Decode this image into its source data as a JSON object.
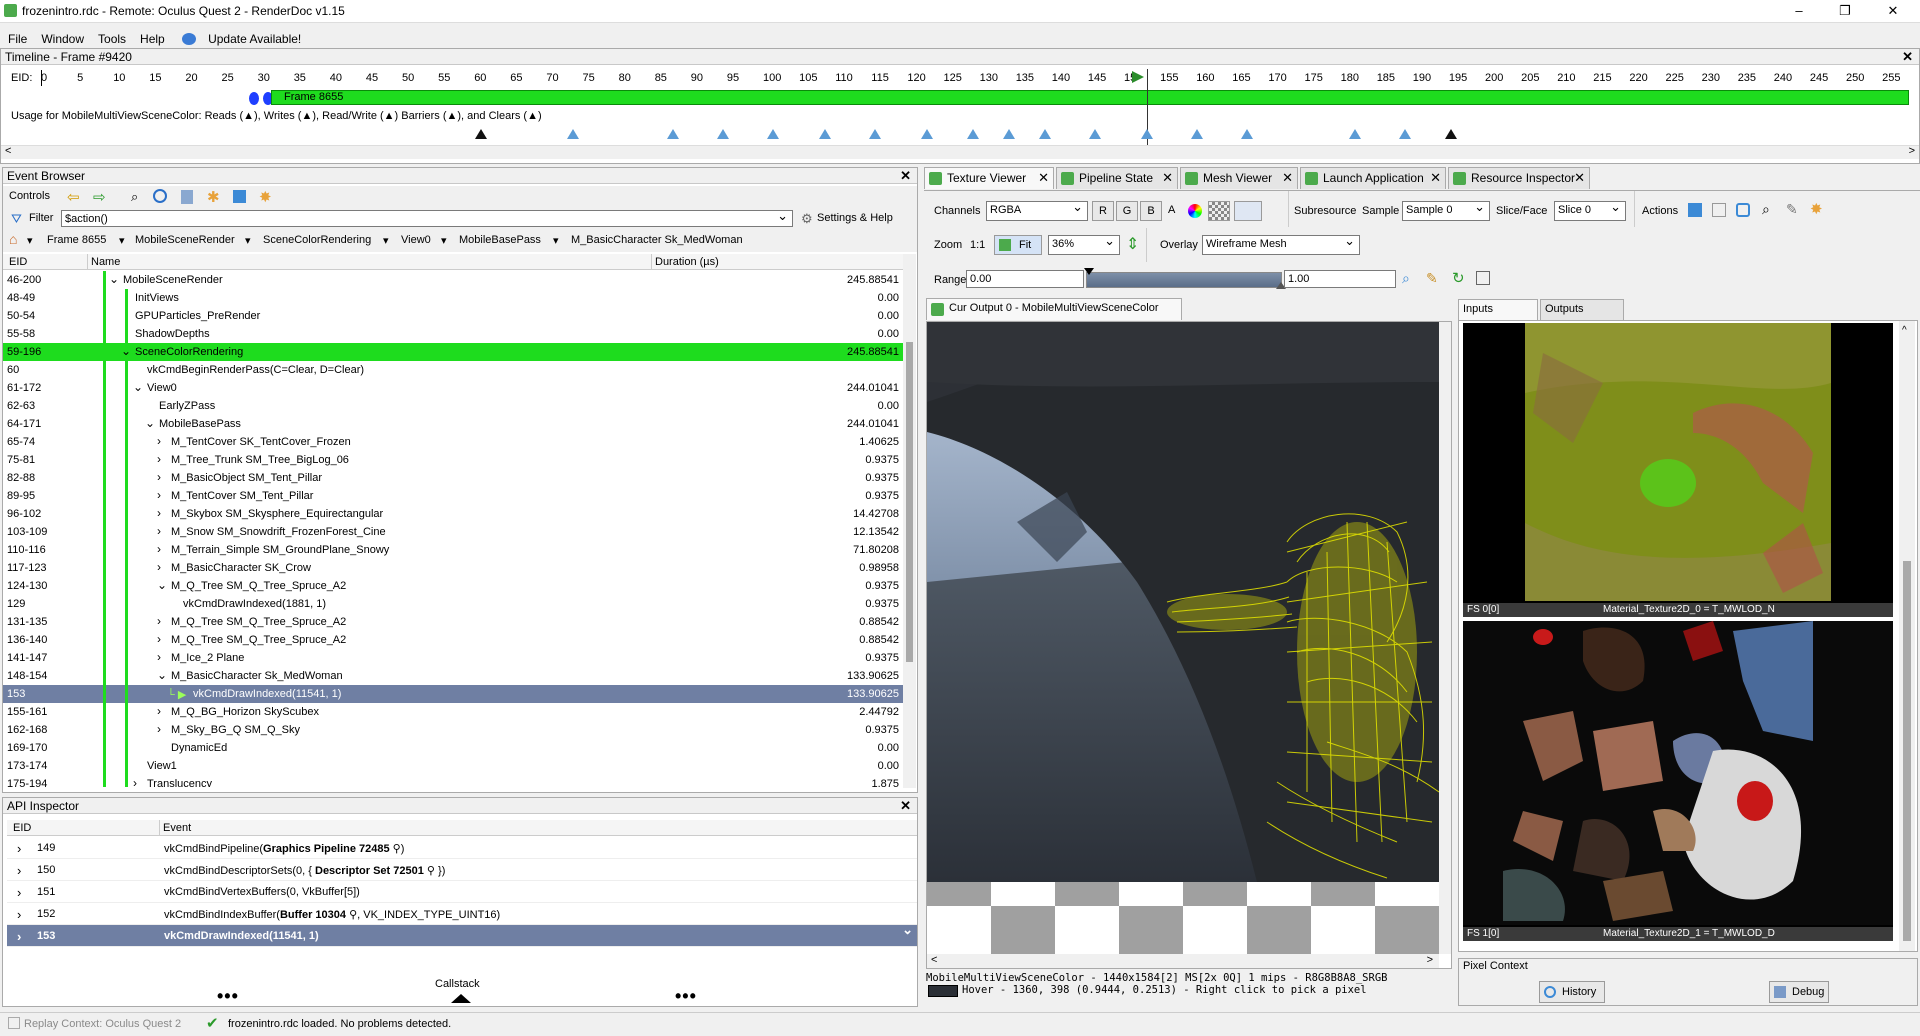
{
  "window": {
    "title": "frozenintro.rdc - Remote: Oculus Quest 2 - RenderDoc v1.15"
  },
  "menu": {
    "items": [
      "File",
      "Window",
      "Tools",
      "Help"
    ],
    "update": "Update Available!"
  },
  "timeline": {
    "header": "Timeline - Frame #9420",
    "eid_label": "EID:",
    "ticks": [
      "0",
      "5",
      "10",
      "15",
      "20",
      "25",
      "30",
      "35",
      "40",
      "45",
      "50",
      "55",
      "60",
      "65",
      "70",
      "75",
      "80",
      "85",
      "90",
      "95",
      "100",
      "105",
      "110",
      "115",
      "120",
      "125",
      "130",
      "135",
      "140",
      "145",
      "15",
      "155",
      "160",
      "165",
      "170",
      "175",
      "180",
      "185",
      "190",
      "195",
      "200",
      "205",
      "210",
      "215",
      "220",
      "225",
      "230",
      "235",
      "240",
      "245",
      "250",
      "255"
    ],
    "frame_bar": "Frame 8655",
    "usage": "Usage for MobileMultiViewSceneColor: Reads (▲), Writes (▲), Read/Write (▲) Barriers (▲), and Clears (▲)"
  },
  "event_browser": {
    "header": "Event Browser",
    "controls_label": "Controls",
    "filter_label": "Filter",
    "filter_value": "$action()",
    "settings": "Settings & Help",
    "breadcrumbs": [
      "Frame 8655",
      "MobileSceneRender",
      "SceneColorRendering",
      "View0",
      "MobileBasePass",
      "M_BasicCharacter Sk_MedWoman"
    ],
    "columns": {
      "eid": "EID",
      "name": "Name",
      "duration": "Duration (µs)"
    },
    "rows": [
      {
        "eid": "46-200",
        "name": "MobileSceneRender",
        "dur": "245.88541",
        "indent": 0,
        "exp": "v"
      },
      {
        "eid": "48-49",
        "name": "InitViews",
        "dur": "0.00",
        "indent": 1,
        "exp": ""
      },
      {
        "eid": "50-54",
        "name": "GPUParticles_PreRender",
        "dur": "0.00",
        "indent": 1,
        "exp": ""
      },
      {
        "eid": "55-58",
        "name": "ShadowDepths",
        "dur": "0.00",
        "indent": 1,
        "exp": ""
      },
      {
        "eid": "59-196",
        "name": "SceneColorRendering",
        "dur": "245.88541",
        "indent": 1,
        "exp": "v",
        "hl": "green"
      },
      {
        "eid": "60",
        "name": "vkCmdBeginRenderPass(C=Clear, D=Clear)",
        "dur": "",
        "indent": 2,
        "exp": ""
      },
      {
        "eid": "61-172",
        "name": "View0",
        "dur": "244.01041",
        "indent": 2,
        "exp": "v"
      },
      {
        "eid": "62-63",
        "name": "EarlyZPass",
        "dur": "0.00",
        "indent": 3,
        "exp": ""
      },
      {
        "eid": "64-171",
        "name": "MobileBasePass",
        "dur": "244.01041",
        "indent": 3,
        "exp": "v"
      },
      {
        "eid": "65-74",
        "name": "M_TentCover SK_TentCover_Frozen",
        "dur": "1.40625",
        "indent": 4,
        "exp": ">"
      },
      {
        "eid": "75-81",
        "name": "M_Tree_Trunk SM_Tree_BigLog_06",
        "dur": "0.9375",
        "indent": 4,
        "exp": ">"
      },
      {
        "eid": "82-88",
        "name": "M_BasicObject SM_Tent_Pillar",
        "dur": "0.9375",
        "indent": 4,
        "exp": ">"
      },
      {
        "eid": "89-95",
        "name": "M_TentCover SM_Tent_Pillar",
        "dur": "0.9375",
        "indent": 4,
        "exp": ">"
      },
      {
        "eid": "96-102",
        "name": "M_Skybox SM_Skysphere_Equirectangular",
        "dur": "14.42708",
        "indent": 4,
        "exp": ">"
      },
      {
        "eid": "103-109",
        "name": "M_Snow SM_Snowdrift_FrozenForest_Cine",
        "dur": "12.13542",
        "indent": 4,
        "exp": ">"
      },
      {
        "eid": "110-116",
        "name": "M_Terrain_Simple SM_GroundPlane_Snowy",
        "dur": "71.80208",
        "indent": 4,
        "exp": ">"
      },
      {
        "eid": "117-123",
        "name": "M_BasicCharacter SK_Crow",
        "dur": "0.98958",
        "indent": 4,
        "exp": ">"
      },
      {
        "eid": "124-130",
        "name": "M_Q_Tree SM_Q_Tree_Spruce_A2",
        "dur": "0.9375",
        "indent": 4,
        "exp": "v"
      },
      {
        "eid": "129",
        "name": "vkCmdDrawIndexed(1881, 1)",
        "dur": "0.9375",
        "indent": 5,
        "exp": ""
      },
      {
        "eid": "131-135",
        "name": "M_Q_Tree SM_Q_Tree_Spruce_A2",
        "dur": "0.88542",
        "indent": 4,
        "exp": ">"
      },
      {
        "eid": "136-140",
        "name": "M_Q_Tree SM_Q_Tree_Spruce_A2",
        "dur": "0.88542",
        "indent": 4,
        "exp": ">"
      },
      {
        "eid": "141-147",
        "name": "M_Ice_2 Plane",
        "dur": "0.9375",
        "indent": 4,
        "exp": ">"
      },
      {
        "eid": "148-154",
        "name": "M_BasicCharacter Sk_MedWoman",
        "dur": "133.90625",
        "indent": 4,
        "exp": "v"
      },
      {
        "eid": "153",
        "name": "vkCmdDrawIndexed(11541, 1)",
        "dur": "133.90625",
        "indent": 5,
        "exp": "",
        "hl": "sel"
      },
      {
        "eid": "155-161",
        "name": "M_Q_BG_Horizon SkyScubex",
        "dur": "2.44792",
        "indent": 4,
        "exp": ">"
      },
      {
        "eid": "162-168",
        "name": "M_Sky_BG_Q SM_Q_Sky",
        "dur": "0.9375",
        "indent": 4,
        "exp": ">"
      },
      {
        "eid": "169-170",
        "name": "DynamicEd",
        "dur": "0.00",
        "indent": 4,
        "exp": ""
      },
      {
        "eid": "173-174",
        "name": "View1",
        "dur": "0.00",
        "indent": 2,
        "exp": ""
      },
      {
        "eid": "175-194",
        "name": "Translucency",
        "dur": "1.875",
        "indent": 2,
        "exp": ">"
      }
    ]
  },
  "api_inspector": {
    "header": "API Inspector",
    "columns": {
      "eid": "EID",
      "event": "Event"
    },
    "rows": [
      {
        "eid": "149",
        "pre": "vkCmdBindPipeline(",
        "bold": "Graphics Pipeline 72485",
        "post": ")"
      },
      {
        "eid": "150",
        "pre": "vkCmdBindDescriptorSets(0, { ",
        "bold": "Descriptor Set 72501",
        "post": " })"
      },
      {
        "eid": "151",
        "pre": "vkCmdBindVertexBuffers(0, VkBuffer[5])",
        "bold": "",
        "post": ""
      },
      {
        "eid": "152",
        "pre": "vkCmdBindIndexBuffer(",
        "bold": "Buffer 10304",
        "post": ", VK_INDEX_TYPE_UINT16)"
      },
      {
        "eid": "153",
        "pre": "vkCmdDrawIndexed(11541, 1)",
        "bold": "",
        "post": "",
        "sel": true
      }
    ],
    "callstack": "Callstack"
  },
  "tabs": [
    "Texture Viewer",
    "Pipeline State",
    "Mesh Viewer",
    "Launch Application",
    "Resource Inspector"
  ],
  "texture_viewer": {
    "channels_label": "Channels",
    "channels_value": "RGBA",
    "chan_r": "R",
    "chan_g": "G",
    "chan_b": "B",
    "chan_a": "A",
    "subresource_label": "Subresource",
    "sample_label": "Sample",
    "sample_value": "Sample 0",
    "slice_label": "Slice/Face",
    "slice_value": "Slice 0",
    "actions_label": "Actions",
    "zoom_label": "Zoom",
    "zoom_1to1": "1:1",
    "fit_label": "Fit",
    "zoom_value": "36%",
    "overlay_label": "Overlay",
    "overlay_value": "Wireframe Mesh",
    "range_label": "Range",
    "range_min": "0.00",
    "range_max": "1.00",
    "output_tab": "Cur Output 0 - MobileMultiViewSceneColor",
    "status_line1": "MobileMultiViewSceneColor - 1440x1584[2] MS[2x 0Q] 1 mips - R8G8B8A8_SRGB",
    "status_line2": "Hover -   1360,  398 (0.9444, 0.2513) - Right click to pick a pixel"
  },
  "thumbs": {
    "inputs_tab": "Inputs",
    "outputs_tab": "Outputs",
    "t0_slot": "FS 0[0]",
    "t0_name": "Material_Texture2D_0 = T_MWLOD_N",
    "t1_slot": "FS 1[0]",
    "t1_name": "Material_Texture2D_1 = T_MWLOD_D"
  },
  "pixel_context": {
    "header": "Pixel Context",
    "history": "History",
    "debug": "Debug"
  },
  "statusbar": {
    "replay": "Replay Context: Oculus Quest 2",
    "msg": "frozenintro.rdc loaded. No problems detected."
  }
}
